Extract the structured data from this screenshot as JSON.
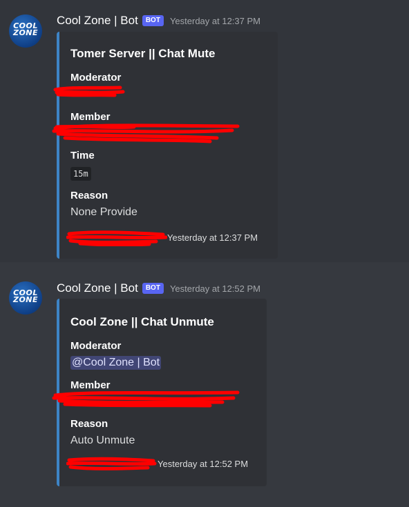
{
  "messages": [
    {
      "username": "Cool Zone | Bot",
      "bot_tag": "BOT",
      "timestamp": "Yesterday at 12:37 PM",
      "avatar_logo": [
        "COOL",
        "ZONE"
      ],
      "embed": {
        "title": "Tomer Server ||  Chat Mute",
        "accent_color": "#3d84c6",
        "fields": {
          "moderator_name": "Moderator",
          "member_name": "Member",
          "time_name": "Time",
          "time_value": "15m",
          "reason_name": "Reason",
          "reason_value": "None Provide"
        },
        "footer_timestamp": "Yesterday at 12:37 PM"
      }
    },
    {
      "username": "Cool Zone | Bot",
      "bot_tag": "BOT",
      "timestamp": "Yesterday at 12:52 PM",
      "avatar_logo": [
        "COOL",
        "ZONE"
      ],
      "embed": {
        "title": "Cool Zone ||  Chat Unmute",
        "accent_color": "#3d84c6",
        "fields": {
          "moderator_name": "Moderator",
          "moderator_value": "@Cool Zone | Bot",
          "member_name": "Member",
          "reason_name": "Reason",
          "reason_value": "Auto Unmute"
        },
        "footer_timestamp": "Yesterday at 12:52 PM"
      }
    }
  ],
  "colors": {
    "background": "#36393f",
    "embed_background": "#2f3136",
    "bot_tag": "#5865f2",
    "redaction": "#ff0000",
    "mention_background": "#414675"
  }
}
